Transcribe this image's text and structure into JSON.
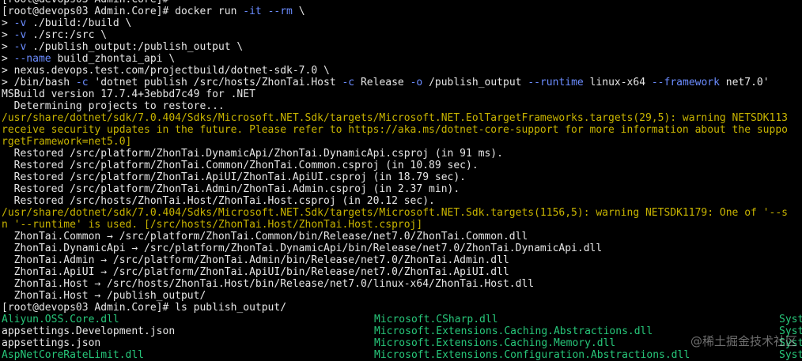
{
  "colors": {
    "background": "#000000",
    "text": "#e6e6e6",
    "warning": "#c8b400",
    "flag": "#6b8cff",
    "green_file": "#27c77a"
  },
  "lines": [
    {
      "kind": "plain",
      "segments": [
        {
          "t": "[root@devops03 Admin.Core]#",
          "c": "white"
        }
      ]
    },
    {
      "kind": "plain",
      "segments": [
        {
          "t": "[root@devops03 Admin.Core]# docker run ",
          "c": "white"
        },
        {
          "t": "-it",
          "c": "flag"
        },
        {
          "t": " ",
          "c": "white"
        },
        {
          "t": "--rm",
          "c": "flag"
        },
        {
          "t": " \\",
          "c": "white"
        }
      ]
    },
    {
      "kind": "plain",
      "segments": [
        {
          "t": "> ",
          "c": "white"
        },
        {
          "t": "-v",
          "c": "flag"
        },
        {
          "t": " ./build:/build \\",
          "c": "white"
        }
      ]
    },
    {
      "kind": "plain",
      "segments": [
        {
          "t": "> ",
          "c": "white"
        },
        {
          "t": "-v",
          "c": "flag"
        },
        {
          "t": " ./src:/src \\",
          "c": "white"
        }
      ]
    },
    {
      "kind": "plain",
      "segments": [
        {
          "t": "> ",
          "c": "white"
        },
        {
          "t": "-v",
          "c": "flag"
        },
        {
          "t": " ./publish_output:/publish_output \\",
          "c": "white"
        }
      ]
    },
    {
      "kind": "plain",
      "segments": [
        {
          "t": "> ",
          "c": "white"
        },
        {
          "t": "--name",
          "c": "flag"
        },
        {
          "t": " build_zhontai_api \\",
          "c": "white"
        }
      ]
    },
    {
      "kind": "plain",
      "segments": [
        {
          "t": "> nexus.devops.test.com/projectbuild/dotnet-sdk-7.0 \\",
          "c": "white"
        }
      ]
    },
    {
      "kind": "plain",
      "segments": [
        {
          "t": "> /bin/bash ",
          "c": "white"
        },
        {
          "t": "-c",
          "c": "flag"
        },
        {
          "t": " 'dotnet publish /src/hosts/ZhonTai.Host ",
          "c": "white"
        },
        {
          "t": "-c",
          "c": "flag"
        },
        {
          "t": " Release ",
          "c": "white"
        },
        {
          "t": "-o",
          "c": "flag"
        },
        {
          "t": " /publish_output ",
          "c": "white"
        },
        {
          "t": "--runtime",
          "c": "flag"
        },
        {
          "t": " linux-x64 ",
          "c": "white"
        },
        {
          "t": "--framework",
          "c": "flag"
        },
        {
          "t": " net7.0'",
          "c": "white"
        }
      ]
    },
    {
      "kind": "plain",
      "segments": [
        {
          "t": "MSBuild version 17.7.4+3ebbd7c49 for .NET",
          "c": "white"
        }
      ]
    },
    {
      "kind": "plain",
      "segments": [
        {
          "t": "  Determining projects to restore...",
          "c": "white"
        }
      ]
    },
    {
      "kind": "plain",
      "segments": [
        {
          "t": "/usr/share/dotnet/sdk/7.0.404/Sdks/Microsoft.NET.Sdk/targets/Microsoft.NET.EolTargetFrameworks.targets(29,5): warning NETSDK113",
          "c": "yellow"
        }
      ]
    },
    {
      "kind": "plain",
      "segments": [
        {
          "t": "receive security updates in the future. Please refer to https://aka.ms/dotnet-core-support for more information about the suppo",
          "c": "yellow"
        }
      ]
    },
    {
      "kind": "plain",
      "segments": [
        {
          "t": "rgetFramework=net5.0]",
          "c": "yellow"
        }
      ]
    },
    {
      "kind": "plain",
      "segments": [
        {
          "t": "  Restored /src/platform/ZhonTai.DynamicApi/ZhonTai.DynamicApi.csproj (in 91 ms).",
          "c": "white"
        }
      ]
    },
    {
      "kind": "plain",
      "segments": [
        {
          "t": "  Restored /src/platform/ZhonTai.Common/ZhonTai.Common.csproj (in 10.89 sec).",
          "c": "white"
        }
      ]
    },
    {
      "kind": "plain",
      "segments": [
        {
          "t": "  Restored /src/platform/ZhonTai.ApiUI/ZhonTai.ApiUI.csproj (in 18.79 sec).",
          "c": "white"
        }
      ]
    },
    {
      "kind": "plain",
      "segments": [
        {
          "t": "  Restored /src/platform/ZhonTai.Admin/ZhonTai.Admin.csproj (in 2.37 min).",
          "c": "white"
        }
      ]
    },
    {
      "kind": "plain",
      "segments": [
        {
          "t": "  Restored /src/hosts/ZhonTai.Host/ZhonTai.Host.csproj (in 20.12 sec).",
          "c": "white"
        }
      ]
    },
    {
      "kind": "plain",
      "segments": [
        {
          "t": "/usr/share/dotnet/sdk/7.0.404/Sdks/Microsoft.NET.Sdk/targets/Microsoft.NET.Sdk.targets(1156,5): warning NETSDK1179: One of '--s",
          "c": "yellow"
        }
      ]
    },
    {
      "kind": "plain",
      "segments": [
        {
          "t": "n '--runtime' is used. [/src/hosts/ZhonTai.Host/ZhonTai.Host.csproj]",
          "c": "yellow"
        }
      ]
    },
    {
      "kind": "plain",
      "segments": [
        {
          "t": "  ZhonTai.Common → /src/platform/ZhonTai.Common/bin/Release/net7.0/ZhonTai.Common.dll",
          "c": "white"
        }
      ]
    },
    {
      "kind": "plain",
      "segments": [
        {
          "t": "  ZhonTai.DynamicApi → /src/platform/ZhonTai.DynamicApi/bin/Release/net7.0/ZhonTai.DynamicApi.dll",
          "c": "white"
        }
      ]
    },
    {
      "kind": "plain",
      "segments": [
        {
          "t": "  ZhonTai.Admin → /src/platform/ZhonTai.Admin/bin/Release/net7.0/ZhonTai.Admin.dll",
          "c": "white"
        }
      ]
    },
    {
      "kind": "plain",
      "segments": [
        {
          "t": "  ZhonTai.ApiUI → /src/platform/ZhonTai.ApiUI/bin/Release/net7.0/ZhonTai.ApiUI.dll",
          "c": "white"
        }
      ]
    },
    {
      "kind": "plain",
      "segments": [
        {
          "t": "  ZhonTai.Host → /src/hosts/ZhonTai.Host/bin/Release/net7.0/linux-x64/ZhonTai.Host.dll",
          "c": "white"
        }
      ]
    },
    {
      "kind": "plain",
      "segments": [
        {
          "t": "  ZhonTai.Host → /publish_output/",
          "c": "white"
        }
      ]
    },
    {
      "kind": "plain",
      "segments": [
        {
          "t": "[root@devops03 Admin.Core]# ls publish_output/",
          "c": "white"
        }
      ]
    }
  ],
  "listing": [
    {
      "cols": [
        {
          "t": "Aliyun.OSS.Core.dll",
          "c": "green"
        },
        {
          "t": "Microsoft.CSharp.dll",
          "c": "green"
        },
        {
          "t": "Syst",
          "c": "green"
        }
      ]
    },
    {
      "cols": [
        {
          "t": "appsettings.Development.json",
          "c": "white"
        },
        {
          "t": "Microsoft.Extensions.Caching.Abstractions.dll",
          "c": "green"
        },
        {
          "t": "Syst",
          "c": "green"
        }
      ]
    },
    {
      "cols": [
        {
          "t": "appsettings.json",
          "c": "white"
        },
        {
          "t": "Microsoft.Extensions.Caching.Memory.dll",
          "c": "green"
        },
        {
          "t": "Syst",
          "c": "green"
        }
      ]
    },
    {
      "cols": [
        {
          "t": "AspNetCoreRateLimit.dll",
          "c": "green"
        },
        {
          "t": "Microsoft.Extensions.Configuration.Abstractions.dll",
          "c": "green"
        },
        {
          "t": "Syst",
          "c": "green"
        }
      ]
    }
  ],
  "watermark": "@稀土掘金技术社区"
}
